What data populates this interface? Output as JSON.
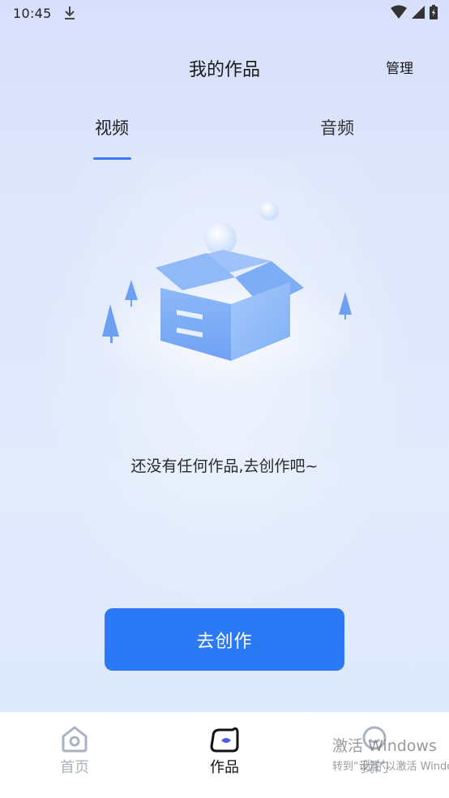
{
  "status_bar": {
    "time": "10:45",
    "icons": [
      "download-icon",
      "wifi-icon",
      "signal-icon",
      "battery-icon"
    ]
  },
  "header": {
    "title": "我的作品",
    "manage_label": "管理"
  },
  "tabs": [
    {
      "label": "视频",
      "active": true
    },
    {
      "label": "音频",
      "active": false
    }
  ],
  "empty_state": {
    "illustration": "empty-box-illustration",
    "message": "还没有任何作品,去创作吧~"
  },
  "create_button": {
    "label": "去创作"
  },
  "bottom_nav": [
    {
      "label": "首页",
      "icon": "home-icon",
      "active": false
    },
    {
      "label": "作品",
      "icon": "works-icon",
      "active": true
    },
    {
      "label": "我的",
      "icon": "profile-icon",
      "active": false
    }
  ],
  "watermark": {
    "title": "激活 Windows",
    "subtitle": "转到“设置”以激活 Windows。"
  },
  "colors": {
    "accent": "#2b79f5",
    "tab_indicator": "#3a7bf0",
    "background": "#dfe8fb"
  }
}
